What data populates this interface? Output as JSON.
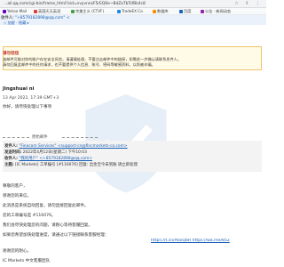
{
  "browser": {
    "url": "…ail.qq.com/cgi-bin/frame_html?sid=nvyvnnsF5rEQ6e~BdZaTbTsfBk4c8kukeaZ6z1a1Ze39",
    "bookmarks": [
      {
        "label": "Yahoo Mail",
        "color": "#6001d2"
      },
      {
        "label": "英国天天英语",
        "color": "#e53935"
      },
      {
        "label": "完美主义 (CTVF)",
        "color": "#43a047"
      },
      {
        "label": "TradeEX Co",
        "color": "#1e88e5"
      },
      {
        "label": "数据库",
        "color": "#fb8c00"
      },
      {
        "label": "百度",
        "color": "#1565c0"
      },
      {
        "label": "公告 · 新闻动态",
        "color": "#8e24aa"
      }
    ]
  },
  "mail": {
    "recipient_prefix": "收件人:",
    "recipient": "\"+8579182898@qq.com\" <",
    "links": "◇ 加星 · 隐藏 ▸",
    "warning": {
      "title": "请勿轻信",
      "line1": "该邮件可能对你的账户存在安全风险，请谨慎处理，不要点击邮件中的链接，如需进一步确认请联系发件人。",
      "line2": "请勿回复此邮件中的任何请求，也不要提供个人信息、账号、密码等敏感资料，以防被诈骗。"
    },
    "sender": "Jingshuai ni",
    "date": "13 Apr 2022, 17:39 GMT+3",
    "greeting": "你好，请尽快处理以下事项",
    "original_label": "原始邮件",
    "original": {
      "from_label": "发件人:",
      "from": "\"Finocom Services\" <support-cn@fincmarkets-co.com>",
      "date_label": "发送时间:",
      "date": "2022年4月12日(星期二) 下午10:03",
      "to_label": "收件人:",
      "to": "\"我的用户\" <+8579182898@qq.com>",
      "subject_label": "主题:",
      "subject": "[IC Markets] 工单编号 [#116076] 回复: 出金至今未到账 请立即处理"
    },
    "body": [
      "尊敬的客户，",
      "感谢您的来信。",
      "此消息是系统自动回复，请勿直接回复此邮件。",
      "您的工单编号是 #116076。",
      "我们会尽快处理您的问题，请耐心等待客服回复。",
      "如果您希望加快处理进度，请通过以下链接联系客服经理：",
      "https://t.cn/A6xQbR  https://wa.me/852",
      "谢谢您的耐心。",
      "IC Markets 中文客服团队"
    ]
  }
}
